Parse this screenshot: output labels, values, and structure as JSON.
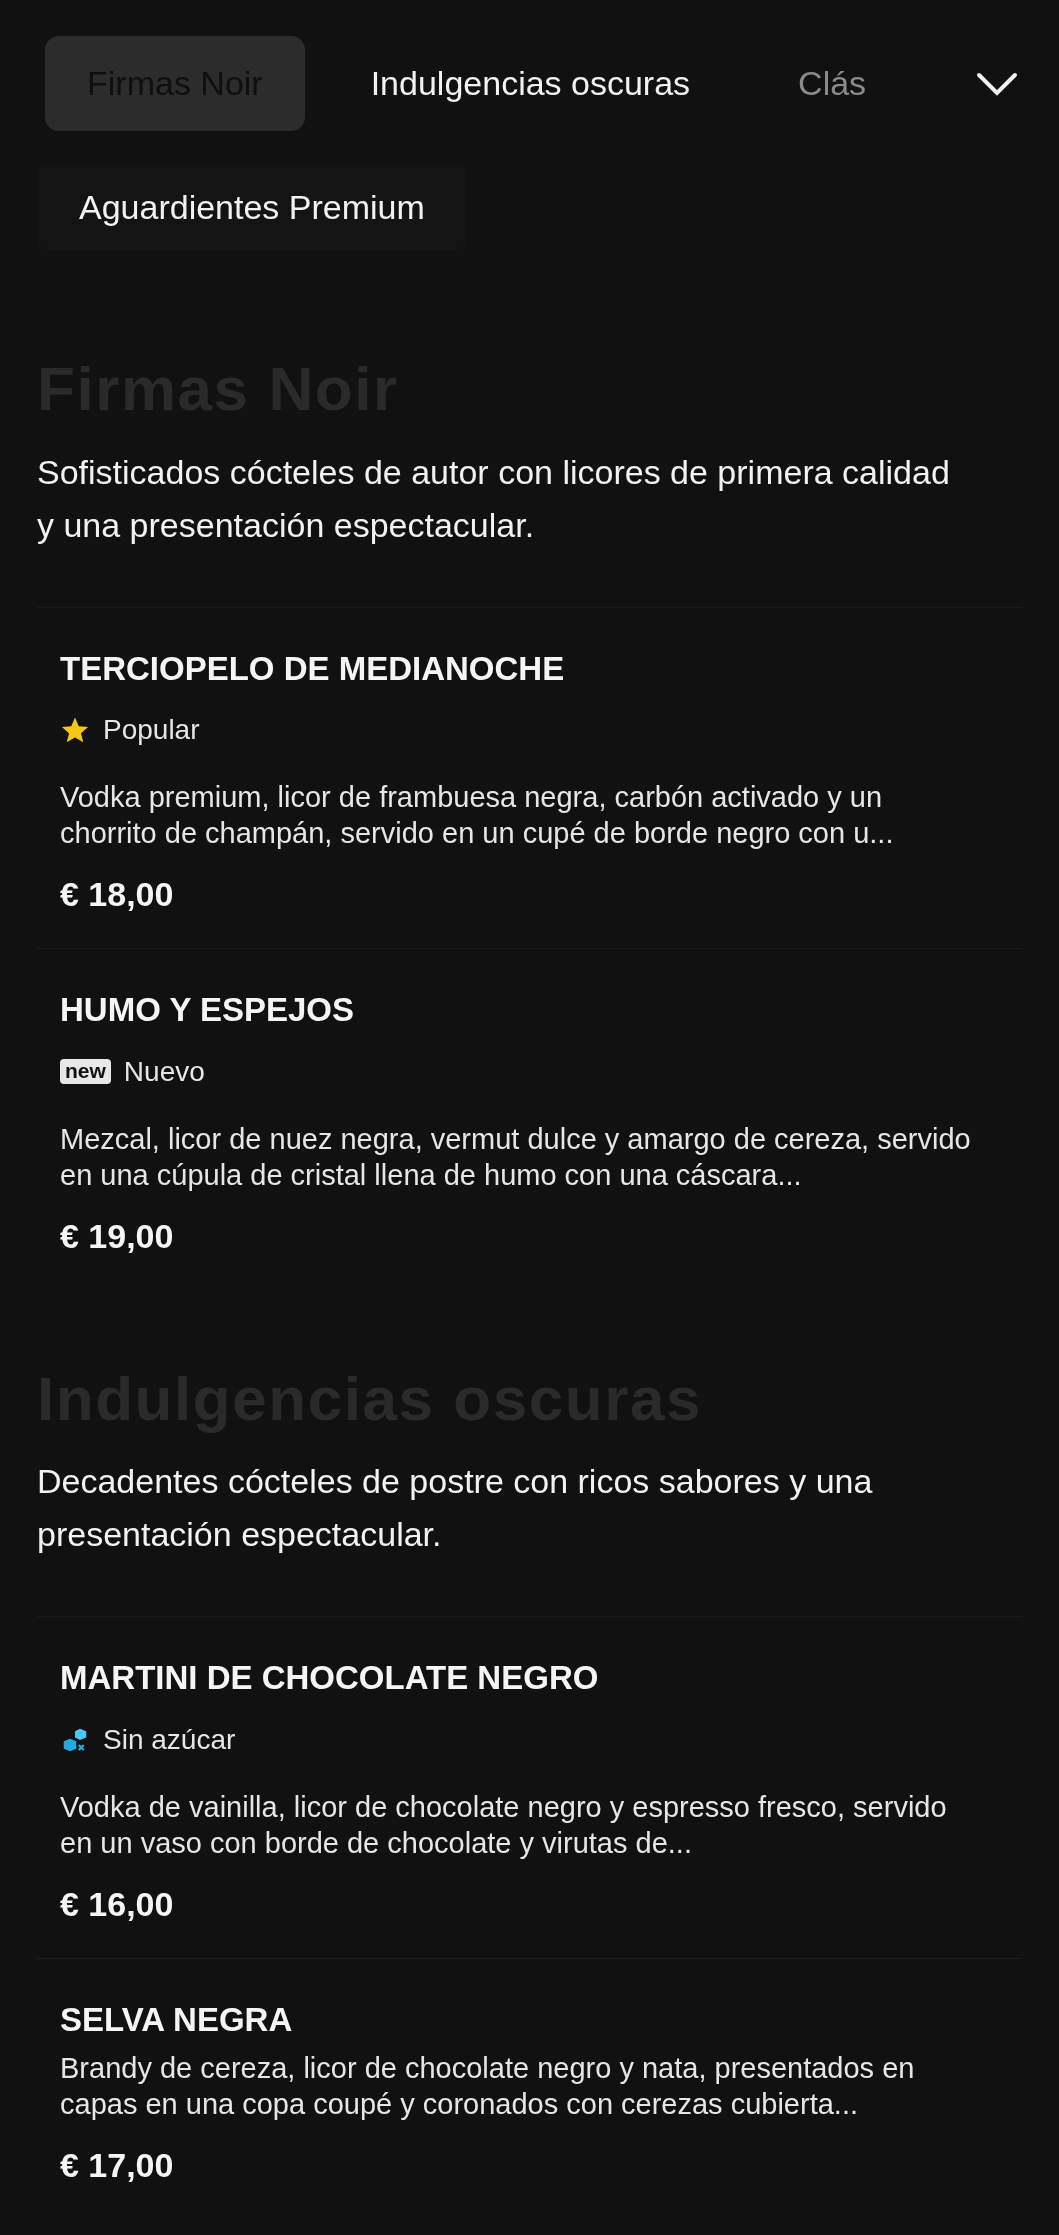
{
  "tabs": [
    {
      "label": "Firmas Noir",
      "selected": true
    },
    {
      "label": "Indulgencias oscuras",
      "selected": false
    },
    {
      "label": "Clás",
      "selected": false,
      "cut": true
    }
  ],
  "second_row_tabs": [
    {
      "label": "Aguardientes Premium",
      "selected": false
    }
  ],
  "sections": [
    {
      "title": "Firmas Noir",
      "description": "Sofisticados cócteles de autor con licores de primera calidad y una presentación espectacular.",
      "items": [
        {
          "name": "TERCIOPELO DE MEDIANOCHE",
          "tag": {
            "kind": "star",
            "label": "Popular"
          },
          "description": "Vodka premium, licor de frambuesa negra, carbón activado y un chorrito de champán, servido en un cupé de borde negro con u...",
          "price": "€ 18,00"
        },
        {
          "name": "HUMO Y ESPEJOS",
          "tag": {
            "kind": "new",
            "icon_text": "new",
            "label": "Nuevo"
          },
          "description": "Mezcal, licor de nuez negra, vermut dulce y amargo de cereza, servido en una cúpula de cristal llena de humo con una cáscara...",
          "price": "€ 19,00"
        }
      ]
    },
    {
      "title": "Indulgencias oscuras",
      "description": "Decadentes cócteles de postre con ricos sabores y una presentación espectacular.",
      "items": [
        {
          "name": "MARTINI DE CHOCOLATE NEGRO",
          "tag": {
            "kind": "sugar_free",
            "label": "Sin azúcar"
          },
          "description": "Vodka de vainilla, licor de chocolate negro y espresso fresco, servido en un vaso con borde de chocolate y virutas de...",
          "price": "€ 16,00"
        },
        {
          "name": "SELVA NEGRA",
          "description": "Brandy de cereza, licor de chocolate negro y nata, presentados en capas en una copa coupé y coronados con cerezas cubierta...",
          "price": "€ 17,00"
        }
      ]
    }
  ]
}
